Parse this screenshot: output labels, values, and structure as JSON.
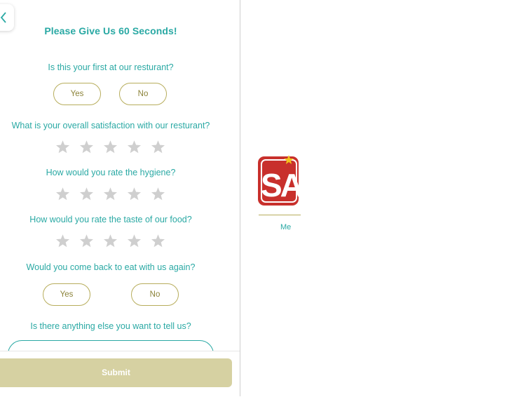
{
  "survey": {
    "title": "Please Give Us 60 Seconds!",
    "q1": {
      "text": "Is this your first at our resturant?",
      "yes": "Yes",
      "no": "No"
    },
    "q2": {
      "text": "What is your overall satisfaction with our resturant?",
      "rating": 0,
      "max": 5
    },
    "q3": {
      "text": "How would you rate the hygiene?",
      "rating": 0,
      "max": 5
    },
    "q4": {
      "text": "How would you rate the taste of our food?",
      "rating": 0,
      "max": 5
    },
    "q5": {
      "text": "Would you come back to eat with us again?",
      "yes": "Yes",
      "no": "No"
    },
    "q6": {
      "text": "Is there anything else you want to tell us?"
    },
    "submit_label": "Submit"
  },
  "brand": {
    "logo_text": "SA",
    "menu_link": "Me"
  },
  "colors": {
    "accent_teal": "#2aa9a4",
    "olive": "#b7ad5c",
    "submit_bg": "#d6d1a2",
    "star_empty": "#cfcfcf",
    "logo_red": "#c8302c",
    "logo_star": "#f3c21b"
  },
  "icons": {
    "back": "chevron-left-icon",
    "rating": "star-icon"
  }
}
